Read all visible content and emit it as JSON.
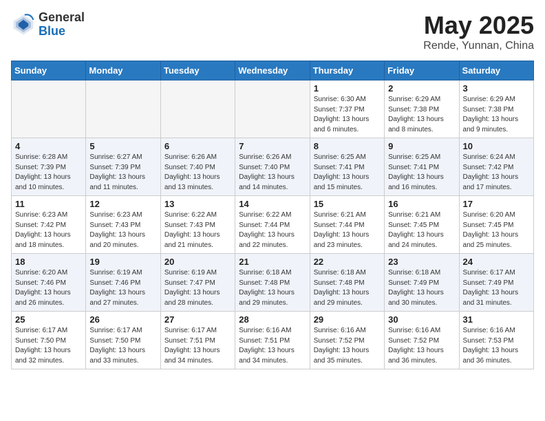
{
  "header": {
    "logo_general": "General",
    "logo_blue": "Blue",
    "month_title": "May 2025",
    "location": "Rende, Yunnan, China"
  },
  "weekdays": [
    "Sunday",
    "Monday",
    "Tuesday",
    "Wednesday",
    "Thursday",
    "Friday",
    "Saturday"
  ],
  "weeks": [
    [
      {
        "day": "",
        "info": ""
      },
      {
        "day": "",
        "info": ""
      },
      {
        "day": "",
        "info": ""
      },
      {
        "day": "",
        "info": ""
      },
      {
        "day": "1",
        "info": "Sunrise: 6:30 AM\nSunset: 7:37 PM\nDaylight: 13 hours\nand 6 minutes."
      },
      {
        "day": "2",
        "info": "Sunrise: 6:29 AM\nSunset: 7:38 PM\nDaylight: 13 hours\nand 8 minutes."
      },
      {
        "day": "3",
        "info": "Sunrise: 6:29 AM\nSunset: 7:38 PM\nDaylight: 13 hours\nand 9 minutes."
      }
    ],
    [
      {
        "day": "4",
        "info": "Sunrise: 6:28 AM\nSunset: 7:39 PM\nDaylight: 13 hours\nand 10 minutes."
      },
      {
        "day": "5",
        "info": "Sunrise: 6:27 AM\nSunset: 7:39 PM\nDaylight: 13 hours\nand 11 minutes."
      },
      {
        "day": "6",
        "info": "Sunrise: 6:26 AM\nSunset: 7:40 PM\nDaylight: 13 hours\nand 13 minutes."
      },
      {
        "day": "7",
        "info": "Sunrise: 6:26 AM\nSunset: 7:40 PM\nDaylight: 13 hours\nand 14 minutes."
      },
      {
        "day": "8",
        "info": "Sunrise: 6:25 AM\nSunset: 7:41 PM\nDaylight: 13 hours\nand 15 minutes."
      },
      {
        "day": "9",
        "info": "Sunrise: 6:25 AM\nSunset: 7:41 PM\nDaylight: 13 hours\nand 16 minutes."
      },
      {
        "day": "10",
        "info": "Sunrise: 6:24 AM\nSunset: 7:42 PM\nDaylight: 13 hours\nand 17 minutes."
      }
    ],
    [
      {
        "day": "11",
        "info": "Sunrise: 6:23 AM\nSunset: 7:42 PM\nDaylight: 13 hours\nand 18 minutes."
      },
      {
        "day": "12",
        "info": "Sunrise: 6:23 AM\nSunset: 7:43 PM\nDaylight: 13 hours\nand 20 minutes."
      },
      {
        "day": "13",
        "info": "Sunrise: 6:22 AM\nSunset: 7:43 PM\nDaylight: 13 hours\nand 21 minutes."
      },
      {
        "day": "14",
        "info": "Sunrise: 6:22 AM\nSunset: 7:44 PM\nDaylight: 13 hours\nand 22 minutes."
      },
      {
        "day": "15",
        "info": "Sunrise: 6:21 AM\nSunset: 7:44 PM\nDaylight: 13 hours\nand 23 minutes."
      },
      {
        "day": "16",
        "info": "Sunrise: 6:21 AM\nSunset: 7:45 PM\nDaylight: 13 hours\nand 24 minutes."
      },
      {
        "day": "17",
        "info": "Sunrise: 6:20 AM\nSunset: 7:45 PM\nDaylight: 13 hours\nand 25 minutes."
      }
    ],
    [
      {
        "day": "18",
        "info": "Sunrise: 6:20 AM\nSunset: 7:46 PM\nDaylight: 13 hours\nand 26 minutes."
      },
      {
        "day": "19",
        "info": "Sunrise: 6:19 AM\nSunset: 7:46 PM\nDaylight: 13 hours\nand 27 minutes."
      },
      {
        "day": "20",
        "info": "Sunrise: 6:19 AM\nSunset: 7:47 PM\nDaylight: 13 hours\nand 28 minutes."
      },
      {
        "day": "21",
        "info": "Sunrise: 6:18 AM\nSunset: 7:48 PM\nDaylight: 13 hours\nand 29 minutes."
      },
      {
        "day": "22",
        "info": "Sunrise: 6:18 AM\nSunset: 7:48 PM\nDaylight: 13 hours\nand 29 minutes."
      },
      {
        "day": "23",
        "info": "Sunrise: 6:18 AM\nSunset: 7:49 PM\nDaylight: 13 hours\nand 30 minutes."
      },
      {
        "day": "24",
        "info": "Sunrise: 6:17 AM\nSunset: 7:49 PM\nDaylight: 13 hours\nand 31 minutes."
      }
    ],
    [
      {
        "day": "25",
        "info": "Sunrise: 6:17 AM\nSunset: 7:50 PM\nDaylight: 13 hours\nand 32 minutes."
      },
      {
        "day": "26",
        "info": "Sunrise: 6:17 AM\nSunset: 7:50 PM\nDaylight: 13 hours\nand 33 minutes."
      },
      {
        "day": "27",
        "info": "Sunrise: 6:17 AM\nSunset: 7:51 PM\nDaylight: 13 hours\nand 34 minutes."
      },
      {
        "day": "28",
        "info": "Sunrise: 6:16 AM\nSunset: 7:51 PM\nDaylight: 13 hours\nand 34 minutes."
      },
      {
        "day": "29",
        "info": "Sunrise: 6:16 AM\nSunset: 7:52 PM\nDaylight: 13 hours\nand 35 minutes."
      },
      {
        "day": "30",
        "info": "Sunrise: 6:16 AM\nSunset: 7:52 PM\nDaylight: 13 hours\nand 36 minutes."
      },
      {
        "day": "31",
        "info": "Sunrise: 6:16 AM\nSunset: 7:53 PM\nDaylight: 13 hours\nand 36 minutes."
      }
    ]
  ]
}
